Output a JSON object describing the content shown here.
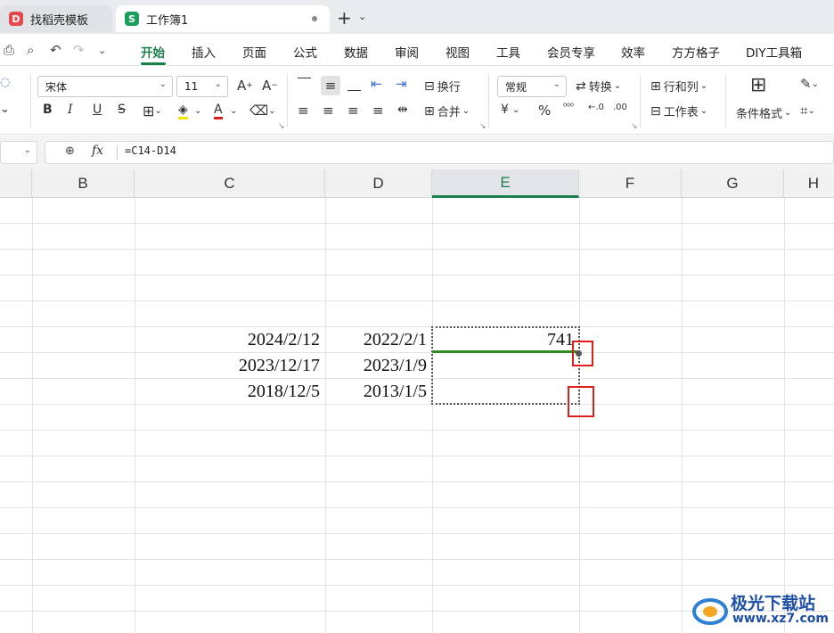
{
  "tabs": [
    {
      "label": "找稻壳模板"
    },
    {
      "label": "工作簿1"
    }
  ],
  "tab_icons": {
    "docer": "D",
    "sheet": "S"
  },
  "menu": {
    "items": [
      "开始",
      "插入",
      "页面",
      "公式",
      "数据",
      "审阅",
      "视图",
      "工具",
      "会员专享",
      "效率",
      "方方格子",
      "DIY工具箱"
    ],
    "active": "开始"
  },
  "ribbon": {
    "font_name": "宋体",
    "font_size": "11",
    "wrap_label": "换行",
    "merge_label": "合并",
    "number_format": "常规",
    "convert_label": "转换",
    "rows_cols_label": "行和列",
    "worksheet_label": "工作表",
    "cond_format_label": "条件格式",
    "bold": "B",
    "italic": "I",
    "underline": "U",
    "strike": "S",
    "grow_font": "A",
    "shrink_font": "A",
    "font_color": "A",
    "percent": "%",
    "currency": "¥"
  },
  "formula_bar": {
    "fx": "fx",
    "formula": "=C14-D14"
  },
  "columns": [
    "B",
    "C",
    "D",
    "E",
    "F",
    "G",
    "H"
  ],
  "selected_column": "E",
  "cells": [
    {
      "col": "C",
      "row": 0,
      "value": "2024/2/12"
    },
    {
      "col": "D",
      "row": 0,
      "value": "2022/2/1"
    },
    {
      "col": "E",
      "row": 0,
      "value": "741"
    },
    {
      "col": "C",
      "row": 1,
      "value": "2023/12/17"
    },
    {
      "col": "D",
      "row": 1,
      "value": "2023/1/9"
    },
    {
      "col": "C",
      "row": 2,
      "value": "2018/12/5"
    },
    {
      "col": "D",
      "row": 2,
      "value": "2013/1/5"
    }
  ],
  "watermark": {
    "line1": "极光下载站",
    "line2": "www.xz7.com"
  },
  "colors": {
    "accent": "#1a7f4b",
    "annotation": "#e0201a"
  }
}
